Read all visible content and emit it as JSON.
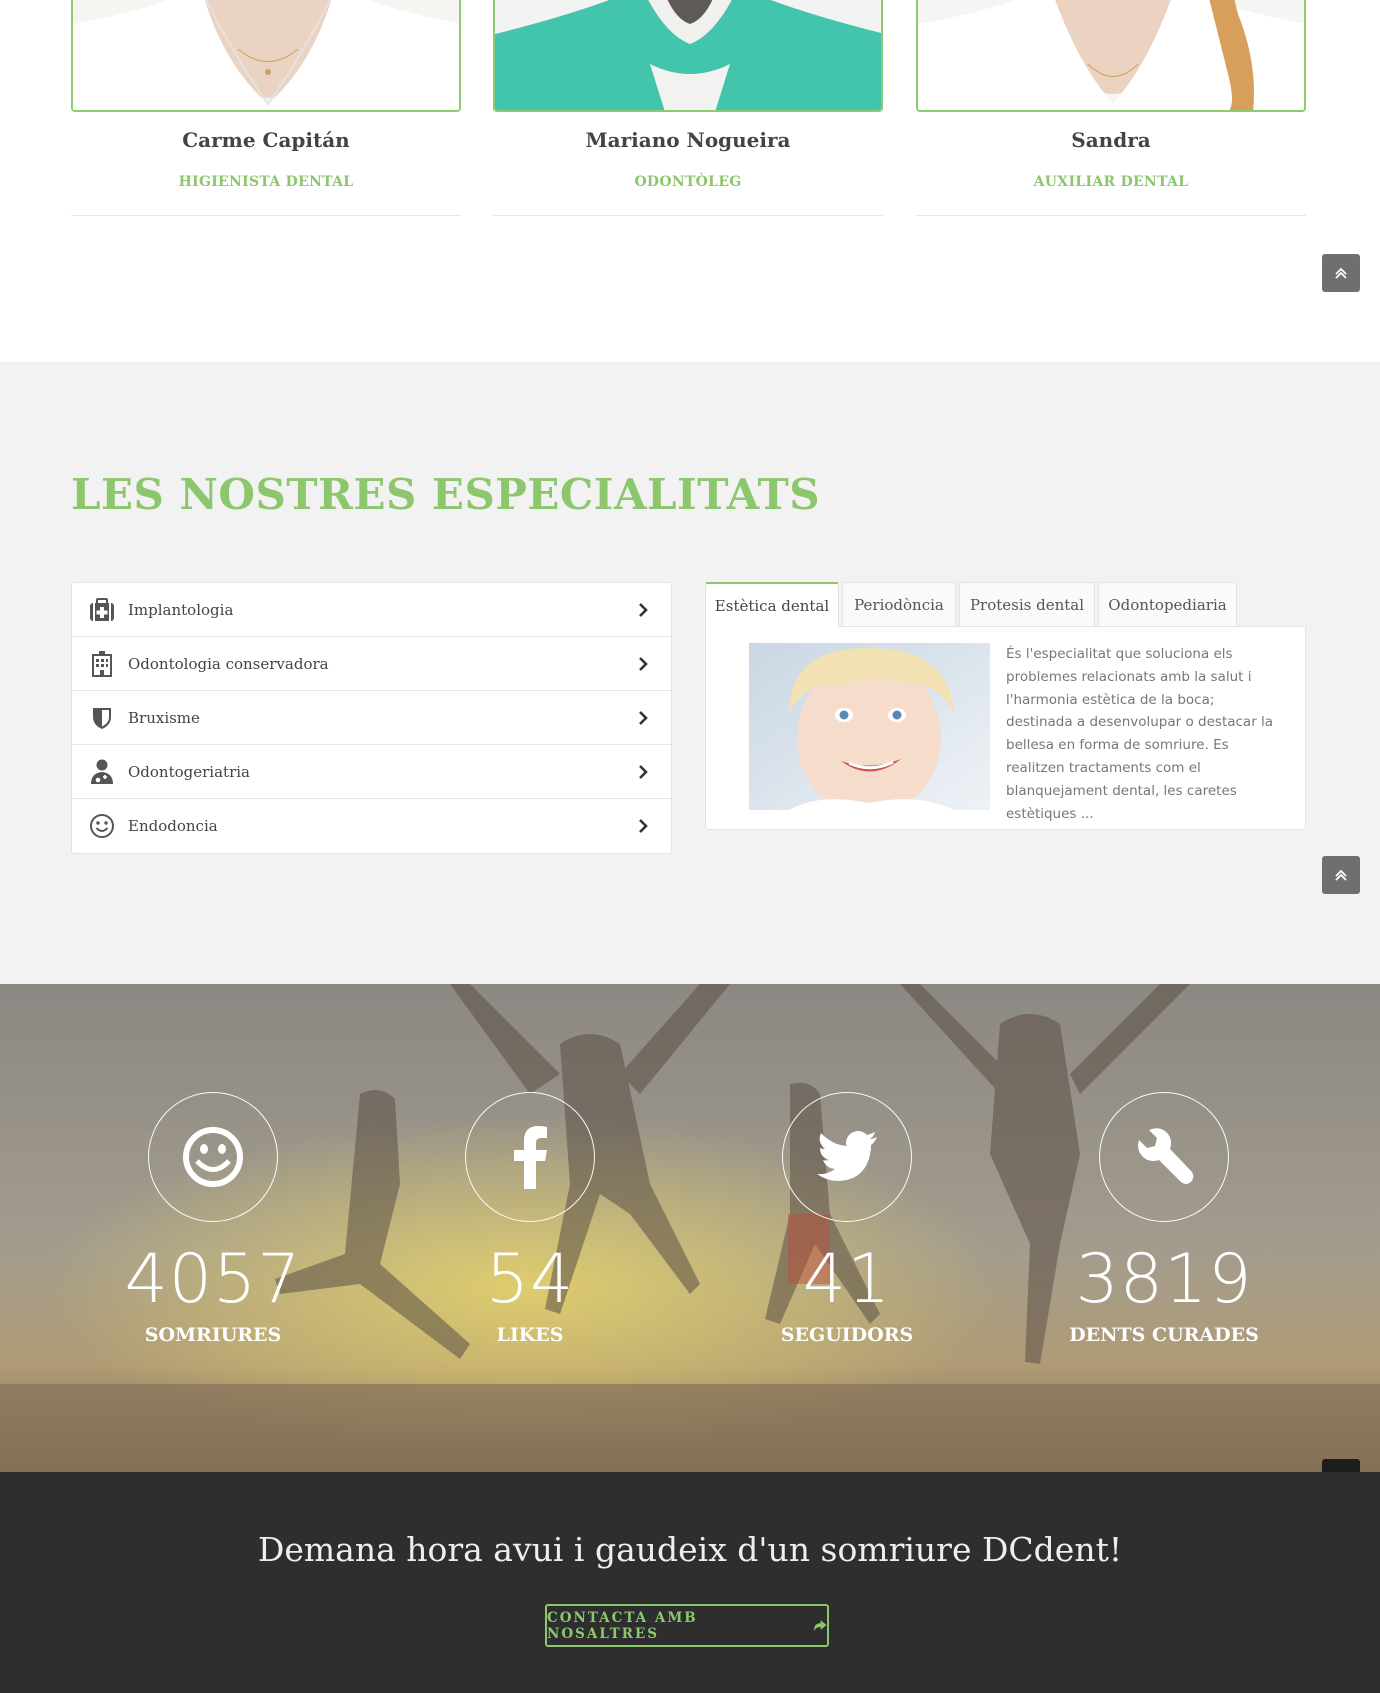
{
  "team": {
    "members": [
      {
        "name": "Carme Capitán",
        "role": "HIGIENISTA DENTAL"
      },
      {
        "name": "Mariano Nogueira",
        "role": "ODONTÒLEG"
      },
      {
        "name": "Sandra",
        "role": "AUXILIAR DENTAL"
      }
    ]
  },
  "specialties": {
    "title": "LES NOSTRES ESPECIALITATS",
    "items": [
      {
        "label": "Implantologia",
        "icon": "medkit-icon"
      },
      {
        "label": "Odontologia conservadora",
        "icon": "hospital-icon"
      },
      {
        "label": "Bruxisme",
        "icon": "shield-icon"
      },
      {
        "label": "Odontogeriatria",
        "icon": "user-doctor-icon"
      },
      {
        "label": "Endodoncia",
        "icon": "smile-icon"
      }
    ],
    "tabs": [
      "Estètica dental",
      "Periodòncia",
      "Protesis dental",
      "Odontopediaria"
    ],
    "active_tab": "Estètica dental",
    "tab_text": "És l'especialitat que soluciona els problemes relacionats amb la salut i l'harmonia estètica de la boca; destinada a desenvolupar o destacar la bellesa en forma de somriure. Es realitzen tractaments com el blanquejament dental, les caretes estètiques ..."
  },
  "counters": [
    {
      "value": "4057",
      "label": "SOMRIURES",
      "icon": "smile-icon"
    },
    {
      "value": "54",
      "label": "LIKES",
      "icon": "facebook-icon"
    },
    {
      "value": "41",
      "label": "SEGUIDORS",
      "icon": "twitter-icon"
    },
    {
      "value": "3819",
      "label": "DENTS CURADES",
      "icon": "wrench-icon"
    }
  ],
  "cta": {
    "text": "Demana hora avui i gaudeix d'un somriure DCdent!",
    "button_label": "CONTACTA AMB NOSALTRES"
  },
  "colors": {
    "accent": "#8cc66d",
    "dark": "#2e2e2e",
    "light_bg": "#f2f2f2"
  }
}
